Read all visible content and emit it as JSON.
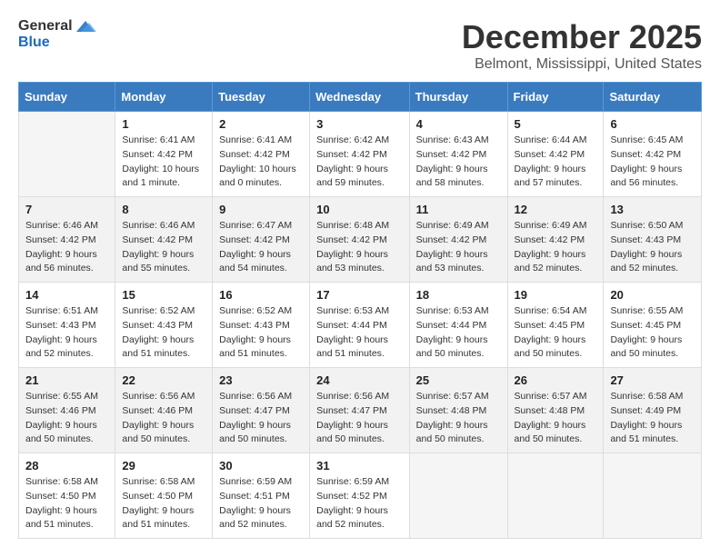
{
  "header": {
    "logo_general": "General",
    "logo_blue": "Blue",
    "month_title": "December 2025",
    "location": "Belmont, Mississippi, United States"
  },
  "calendar": {
    "days_of_week": [
      "Sunday",
      "Monday",
      "Tuesday",
      "Wednesday",
      "Thursday",
      "Friday",
      "Saturday"
    ],
    "weeks": [
      [
        {
          "day": "",
          "info": ""
        },
        {
          "day": "1",
          "info": "Sunrise: 6:41 AM\nSunset: 4:42 PM\nDaylight: 10 hours\nand 1 minute."
        },
        {
          "day": "2",
          "info": "Sunrise: 6:41 AM\nSunset: 4:42 PM\nDaylight: 10 hours\nand 0 minutes."
        },
        {
          "day": "3",
          "info": "Sunrise: 6:42 AM\nSunset: 4:42 PM\nDaylight: 9 hours\nand 59 minutes."
        },
        {
          "day": "4",
          "info": "Sunrise: 6:43 AM\nSunset: 4:42 PM\nDaylight: 9 hours\nand 58 minutes."
        },
        {
          "day": "5",
          "info": "Sunrise: 6:44 AM\nSunset: 4:42 PM\nDaylight: 9 hours\nand 57 minutes."
        },
        {
          "day": "6",
          "info": "Sunrise: 6:45 AM\nSunset: 4:42 PM\nDaylight: 9 hours\nand 56 minutes."
        }
      ],
      [
        {
          "day": "7",
          "info": "Sunrise: 6:46 AM\nSunset: 4:42 PM\nDaylight: 9 hours\nand 56 minutes."
        },
        {
          "day": "8",
          "info": "Sunrise: 6:46 AM\nSunset: 4:42 PM\nDaylight: 9 hours\nand 55 minutes."
        },
        {
          "day": "9",
          "info": "Sunrise: 6:47 AM\nSunset: 4:42 PM\nDaylight: 9 hours\nand 54 minutes."
        },
        {
          "day": "10",
          "info": "Sunrise: 6:48 AM\nSunset: 4:42 PM\nDaylight: 9 hours\nand 53 minutes."
        },
        {
          "day": "11",
          "info": "Sunrise: 6:49 AM\nSunset: 4:42 PM\nDaylight: 9 hours\nand 53 minutes."
        },
        {
          "day": "12",
          "info": "Sunrise: 6:49 AM\nSunset: 4:42 PM\nDaylight: 9 hours\nand 52 minutes."
        },
        {
          "day": "13",
          "info": "Sunrise: 6:50 AM\nSunset: 4:43 PM\nDaylight: 9 hours\nand 52 minutes."
        }
      ],
      [
        {
          "day": "14",
          "info": "Sunrise: 6:51 AM\nSunset: 4:43 PM\nDaylight: 9 hours\nand 52 minutes."
        },
        {
          "day": "15",
          "info": "Sunrise: 6:52 AM\nSunset: 4:43 PM\nDaylight: 9 hours\nand 51 minutes."
        },
        {
          "day": "16",
          "info": "Sunrise: 6:52 AM\nSunset: 4:43 PM\nDaylight: 9 hours\nand 51 minutes."
        },
        {
          "day": "17",
          "info": "Sunrise: 6:53 AM\nSunset: 4:44 PM\nDaylight: 9 hours\nand 51 minutes."
        },
        {
          "day": "18",
          "info": "Sunrise: 6:53 AM\nSunset: 4:44 PM\nDaylight: 9 hours\nand 50 minutes."
        },
        {
          "day": "19",
          "info": "Sunrise: 6:54 AM\nSunset: 4:45 PM\nDaylight: 9 hours\nand 50 minutes."
        },
        {
          "day": "20",
          "info": "Sunrise: 6:55 AM\nSunset: 4:45 PM\nDaylight: 9 hours\nand 50 minutes."
        }
      ],
      [
        {
          "day": "21",
          "info": "Sunrise: 6:55 AM\nSunset: 4:46 PM\nDaylight: 9 hours\nand 50 minutes."
        },
        {
          "day": "22",
          "info": "Sunrise: 6:56 AM\nSunset: 4:46 PM\nDaylight: 9 hours\nand 50 minutes."
        },
        {
          "day": "23",
          "info": "Sunrise: 6:56 AM\nSunset: 4:47 PM\nDaylight: 9 hours\nand 50 minutes."
        },
        {
          "day": "24",
          "info": "Sunrise: 6:56 AM\nSunset: 4:47 PM\nDaylight: 9 hours\nand 50 minutes."
        },
        {
          "day": "25",
          "info": "Sunrise: 6:57 AM\nSunset: 4:48 PM\nDaylight: 9 hours\nand 50 minutes."
        },
        {
          "day": "26",
          "info": "Sunrise: 6:57 AM\nSunset: 4:48 PM\nDaylight: 9 hours\nand 50 minutes."
        },
        {
          "day": "27",
          "info": "Sunrise: 6:58 AM\nSunset: 4:49 PM\nDaylight: 9 hours\nand 51 minutes."
        }
      ],
      [
        {
          "day": "28",
          "info": "Sunrise: 6:58 AM\nSunset: 4:50 PM\nDaylight: 9 hours\nand 51 minutes."
        },
        {
          "day": "29",
          "info": "Sunrise: 6:58 AM\nSunset: 4:50 PM\nDaylight: 9 hours\nand 51 minutes."
        },
        {
          "day": "30",
          "info": "Sunrise: 6:59 AM\nSunset: 4:51 PM\nDaylight: 9 hours\nand 52 minutes."
        },
        {
          "day": "31",
          "info": "Sunrise: 6:59 AM\nSunset: 4:52 PM\nDaylight: 9 hours\nand 52 minutes."
        },
        {
          "day": "",
          "info": ""
        },
        {
          "day": "",
          "info": ""
        },
        {
          "day": "",
          "info": ""
        }
      ]
    ]
  }
}
